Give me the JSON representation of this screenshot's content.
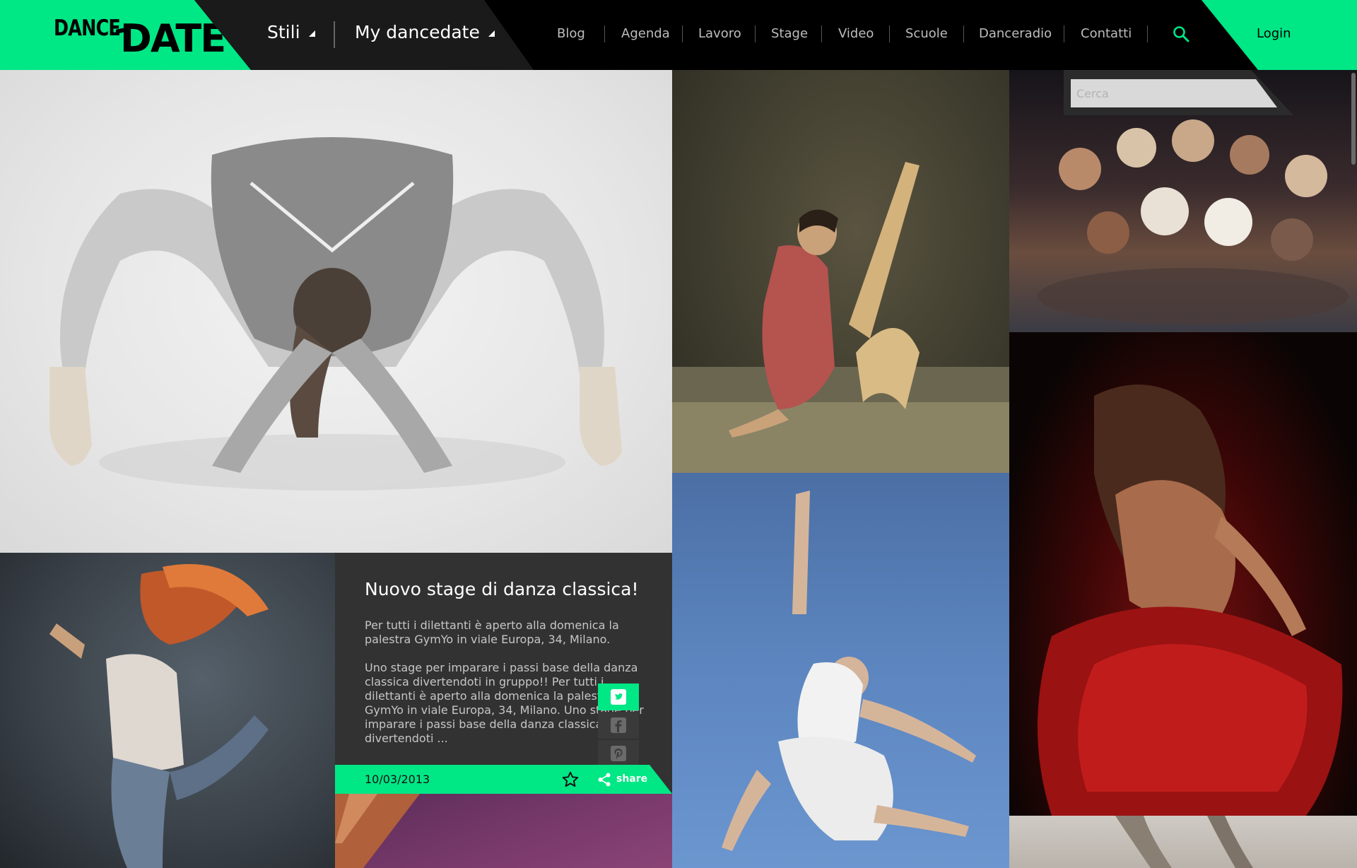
{
  "header": {
    "logo_text_1": "DANCE",
    "logo_text_2": "DATE",
    "menu_stili": "Stili",
    "menu_my": "My dancedate",
    "nav": [
      "Blog",
      "Agenda",
      "Lavoro",
      "Stage",
      "Video",
      "Scuole",
      "Danceradio",
      "Contatti"
    ],
    "login": "Login"
  },
  "search": {
    "placeholder": "Cerca"
  },
  "article": {
    "title": "Nuovo stage di danza classica!",
    "paragraph_1": "Per tutti i dilettanti è aperto alla domenica la palestra GymYo in viale Europa, 34, Milano.",
    "paragraph_2": "Uno stage per imparare i passi base della danza classica divertendoti in gruppo!! Per tutti i dilettanti è aperto alla domenica la palestra GymYo in viale Europa, 34, Milano. Uno stage per imparare i passi base della danza classica divertendoti ...",
    "date": "10/03/2013",
    "share": "share"
  },
  "icons": {
    "search": "search-icon",
    "twitter": "twitter-icon",
    "facebook": "facebook-icon",
    "pinterest": "pinterest-icon",
    "star": "star-icon",
    "share": "share-icon"
  },
  "colors": {
    "accent": "#00e785",
    "header_bg": "#000000",
    "card_bg": "#323232"
  }
}
